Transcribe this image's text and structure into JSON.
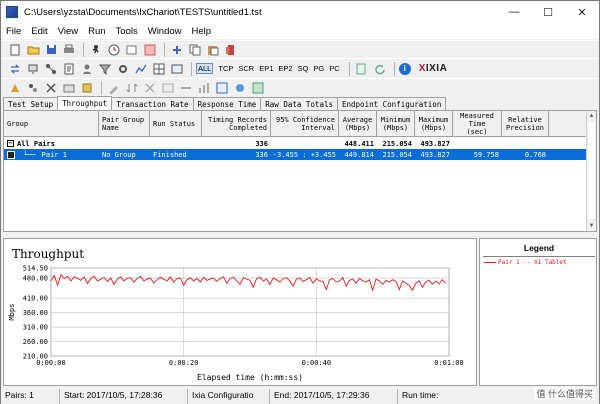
{
  "window": {
    "title": "C:\\Users\\yzsta\\Documents\\IxChariot\\TESTS\\untitled1.tst",
    "min": "—",
    "max": "☐",
    "close": "✕"
  },
  "menu": [
    "File",
    "Edit",
    "View",
    "Run",
    "Tools",
    "Window",
    "Help"
  ],
  "toolbar2": {
    "protocols": [
      "ALL",
      "TCP",
      "SCR",
      "EP1",
      "EP2",
      "SQ",
      "PG",
      "PC"
    ],
    "selected": "ALL",
    "brand_x": "X",
    "brand": "IXIA"
  },
  "tabs": [
    "Test Setup",
    "Throughput",
    "Transaction Rate",
    "Response Time",
    "Raw Data Totals",
    "Endpoint Configuration"
  ],
  "active_tab": "Throughput",
  "grid": {
    "headers": {
      "group": "Group",
      "pair_group_name": "Pair Group Name",
      "run_status": "Run Status",
      "timing_records": "Timing Records Completed",
      "confidence": "95% Confidence Interval",
      "average": "Average (Mbps)",
      "minimum": "Minimum (Mbps)",
      "maximum": "Maximum (Mbps)",
      "measured_time": "Measured Time (sec)",
      "relative_precision": "Relative Precision"
    },
    "all_pairs": {
      "group": "All Pairs",
      "timing_records": "336",
      "average": "448.411",
      "minimum": "215.054",
      "maximum": "493.827"
    },
    "pair1": {
      "group": "Pair 1",
      "pair_group_name": "No Group",
      "run_status": "Finished",
      "timing_records": "336",
      "confidence": "-3.455 : +3.455",
      "average": "449.814",
      "minimum": "215.054",
      "maximum": "493.827",
      "measured_time": "59.758",
      "relative_precision": "0.768"
    }
  },
  "chart": {
    "title": "Throughput"
  },
  "chart_data": {
    "type": "line",
    "title": "Throughput",
    "xlabel": "Elapsed time (h:mm:ss)",
    "ylabel": "Mbps",
    "xlim": [
      0,
      60
    ],
    "ylim": [
      210.0,
      514.5
    ],
    "y_ticks": [
      "514.50",
      "480.00",
      "410.00",
      "360.00",
      "310.00",
      "260.00",
      "210.00"
    ],
    "y_tick_values": [
      514.5,
      480.0,
      410.0,
      360.0,
      310.0,
      260.0,
      210.0
    ],
    "x_ticks": [
      "0:00:00",
      "0:00:20",
      "0:00:40",
      "0:01:00"
    ],
    "x_tick_values": [
      0,
      20,
      40,
      60
    ],
    "grid": true,
    "series": [
      {
        "name": "Pair 1 -- X1 Tablet",
        "color": "#e01818",
        "x": [
          0,
          0.5,
          1,
          1.5,
          2,
          2.5,
          3,
          3.5,
          4,
          4.5,
          5,
          5.5,
          6,
          6.5,
          7,
          7.5,
          8,
          8.5,
          9,
          9.5,
          10,
          10.5,
          11,
          11.5,
          12,
          12.5,
          13,
          13.5,
          14,
          14.5,
          15,
          15.5,
          16,
          16.5,
          17,
          17.5,
          18,
          18.5,
          19,
          19.5,
          20,
          20.5,
          21,
          21.5,
          22,
          22.5,
          23,
          23.5,
          24,
          24.5,
          25,
          25.5,
          26,
          26.5,
          27,
          27.5,
          28,
          28.5,
          29,
          29.5,
          30,
          30.5,
          31,
          31.5,
          32,
          32.5,
          33,
          33.5,
          34,
          34.5,
          35,
          35.5,
          36,
          36.5,
          37,
          37.5,
          38,
          38.5,
          39,
          39.5,
          40,
          40.5,
          41,
          41.5,
          42,
          42.5,
          43,
          43.5,
          44,
          44.5,
          45,
          45.5,
          46,
          46.5,
          47,
          47.5,
          48,
          48.5,
          49,
          49.5,
          50,
          50.5,
          51,
          51.5,
          52,
          52.5,
          53,
          53.5,
          54,
          54.5,
          55,
          55.5,
          56,
          56.5,
          57,
          57.5,
          58,
          58.5,
          59,
          59.5
        ],
        "y": [
          470,
          488,
          455,
          492,
          478,
          486,
          470,
          484,
          479,
          472,
          483,
          461,
          478,
          486,
          470,
          475,
          482,
          468,
          480,
          458,
          476,
          484,
          470,
          479,
          481,
          466,
          478,
          485,
          470,
          476,
          480,
          462,
          474,
          483,
          476,
          470,
          484,
          466,
          478,
          480,
          455,
          474,
          481,
          470,
          478,
          466,
          482,
          472,
          476,
          480,
          468,
          478,
          484,
          462,
          478,
          482,
          470,
          458,
          481,
          476,
          472,
          448,
          478,
          482,
          470,
          476,
          458,
          480,
          474,
          466,
          478,
          481,
          470,
          452,
          476,
          480,
          468,
          474,
          482,
          462,
          477,
          470,
          468,
          440,
          474,
          478,
          466,
          470,
          481,
          452,
          472,
          476,
          462,
          478,
          470,
          466,
          474,
          438,
          476,
          470,
          458,
          472,
          466,
          474,
          468,
          440,
          470,
          462,
          454,
          438,
          462,
          470,
          448,
          466,
          472,
          458,
          469,
          460,
          474,
          462
        ]
      }
    ]
  },
  "legend": {
    "title": "Legend",
    "entry": "Pair 1 -- X1 Tablet"
  },
  "status": {
    "pairs": "Pairs: 1",
    "start": "Start: 2017/10/5, 17:28:36",
    "config": "Ixia Configuratio",
    "end": "End: 2017/10/5, 17:29:36",
    "run_time": "Run time:",
    "watermark": "值 什么值得买"
  }
}
